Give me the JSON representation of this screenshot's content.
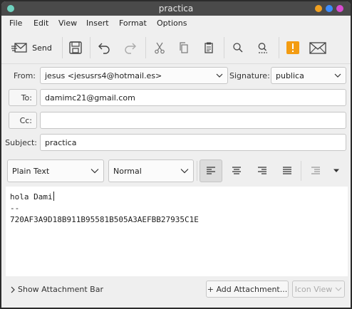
{
  "window": {
    "title": "practica"
  },
  "menu": [
    "File",
    "Edit",
    "View",
    "Insert",
    "Format",
    "Options"
  ],
  "toolbar": {
    "send_label": "Send",
    "icons": [
      "send-icon",
      "save-icon",
      "undo-icon",
      "redo-icon",
      "cut-icon",
      "copy-icon",
      "paste-icon",
      "find-icon",
      "find-replace-icon",
      "urgent-icon",
      "message-icon"
    ]
  },
  "header": {
    "from_label": "From:",
    "from_value": "jesus <jesusrs4@hotmail.es>",
    "signature_label": "Signature:",
    "signature_value": "publica",
    "to_label": "To:",
    "to_value": "damimc21@gmail.com",
    "cc_label": "Cc:",
    "cc_value": "",
    "subject_label": "Subject:",
    "subject_value": "practica"
  },
  "format": {
    "text_type": "Plain Text",
    "paragraph_style": "Normal"
  },
  "body": {
    "lines": [
      "hola Dami",
      "--",
      "720AF3A9D18B911B95581B505A3AEFBB27935C1E"
    ]
  },
  "bottom": {
    "attachment_bar": "Show Attachment Bar",
    "add_attachment": "+ Add Attachment...",
    "icon_view": "Icon View"
  },
  "colors": {
    "titlebar": "#4a4a4a",
    "close_dot": "#3c8cff",
    "max_dot": "#d84bd0",
    "min_dot": "#f0a020",
    "app_dot": "#6fd3c0",
    "urgent": "#f39c12"
  }
}
